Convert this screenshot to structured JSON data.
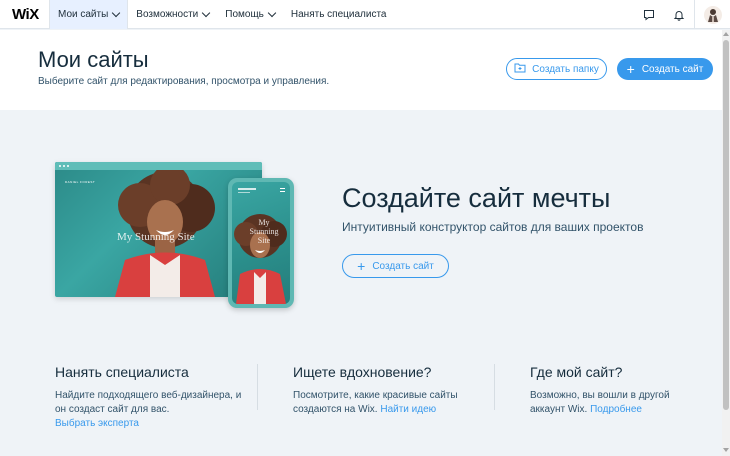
{
  "topbar": {
    "logo": "WiX",
    "nav": [
      {
        "label": "Мои сайты",
        "active": true
      },
      {
        "label": "Возможности"
      },
      {
        "label": "Помощь"
      },
      {
        "label": "Нанять специалиста"
      }
    ],
    "icons": [
      "chat-icon",
      "bell-icon",
      "avatar"
    ]
  },
  "header": {
    "title": "Мои сайты",
    "subtitle": "Выберите сайт для редактирования, просмотра и управления.",
    "create_folder_label": "Создать папку",
    "create_site_label": "Создать сайт"
  },
  "hero": {
    "mock_brand": "DANIEL FOREST",
    "mock_site_text": "My Stunning Site",
    "phone_site_text": "My Stunning Site",
    "title": "Создайте сайт мечты",
    "subtitle": "Интуитивный конструктор сайтов для ваших проектов",
    "button_label": "Создать сайт"
  },
  "columns": [
    {
      "title": "Нанять специалиста",
      "text": "Найдите подходящего веб-дизайнера, и он создаст сайт для вас.",
      "link": "Выбрать эксперта"
    },
    {
      "title": "Ищете вдохновение?",
      "text": "Посмотрите, какие красивые сайты создаются на Wix.",
      "link": "Найти идею"
    },
    {
      "title": "Где мой сайт?",
      "text": "Возможно, вы вошли в другой аккаунт Wix.",
      "link": "Подробнее"
    }
  ],
  "colors": {
    "accent": "#3899ec",
    "title": "#162d3d",
    "background": "#eff3f7"
  }
}
